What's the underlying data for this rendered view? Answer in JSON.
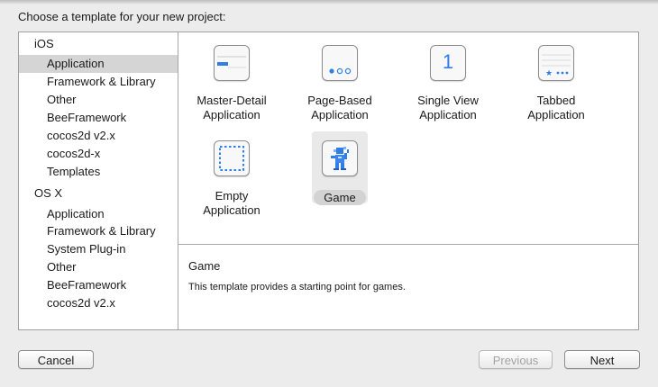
{
  "heading": "Choose a template for your new project:",
  "sidebar": {
    "sections": [
      {
        "title": "iOS",
        "items": [
          "Application",
          "Framework & Library",
          "Other",
          "BeeFramework",
          "cocos2d v2.x",
          "cocos2d-x",
          "Templates"
        ]
      },
      {
        "title": "OS X",
        "items": [
          "Application",
          "Framework & Library",
          "System Plug-in",
          "Other",
          "BeeFramework",
          "cocos2d v2.x"
        ]
      }
    ],
    "selected_item": "Application"
  },
  "templates": [
    {
      "label": "Master-Detail\nApplication",
      "icon": "master-detail-icon"
    },
    {
      "label": "Page-Based\nApplication",
      "icon": "page-based-icon"
    },
    {
      "label": "Single View\nApplication",
      "icon": "single-view-icon",
      "glyph": "1"
    },
    {
      "label": "Tabbed\nApplication",
      "icon": "tabbed-icon"
    },
    {
      "label": "Empty\nApplication",
      "icon": "empty-icon"
    },
    {
      "label": "Game",
      "icon": "game-icon",
      "selected": true
    }
  ],
  "description": {
    "title": "Game",
    "text": "This template provides a starting point for games."
  },
  "buttons": {
    "cancel": "Cancel",
    "previous": "Previous",
    "next": "Next"
  },
  "colors": {
    "accent": "#2f7ee8",
    "selection": "#d5d5d5"
  }
}
